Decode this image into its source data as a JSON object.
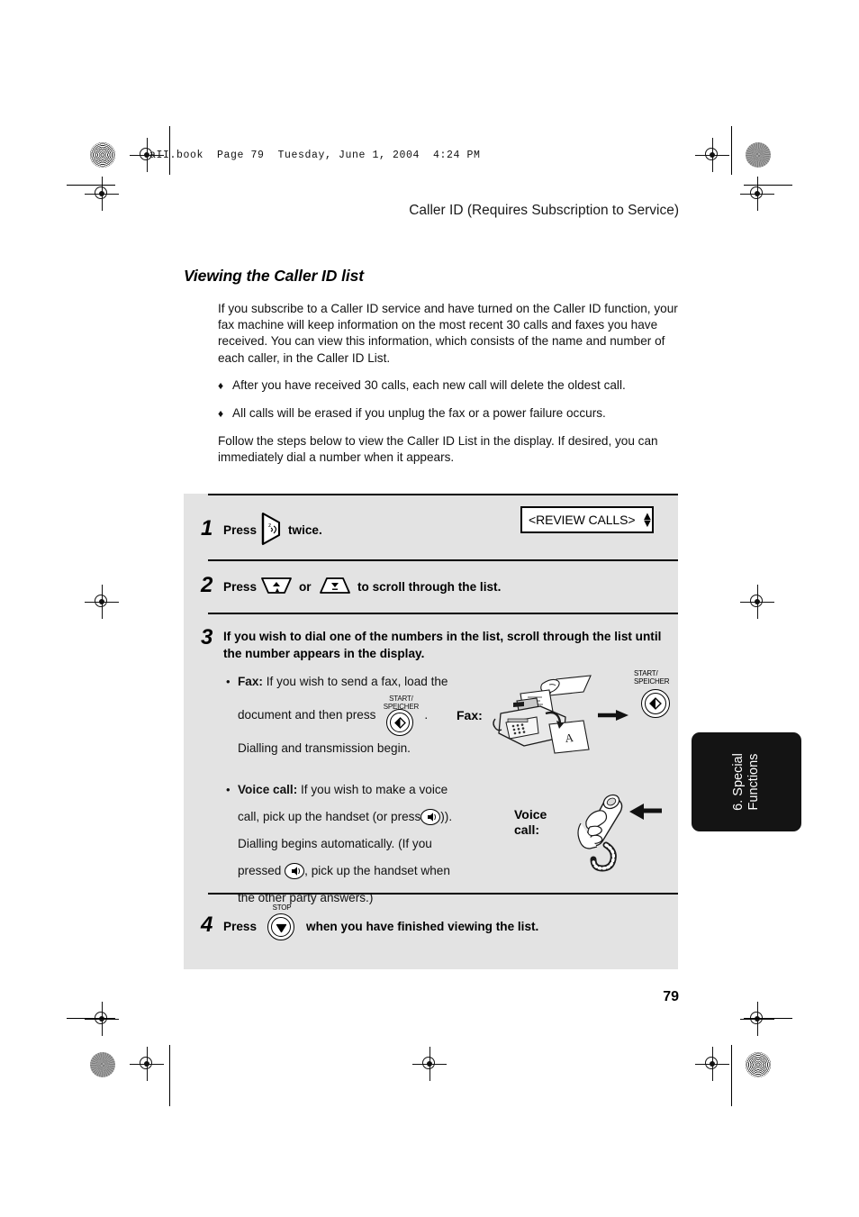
{
  "page": {
    "filename_bar": "aII.book  Page 79  Tuesday, June 1, 2004  4:24 PM",
    "running_head": "Caller ID (Requires Subscription to Service)",
    "section_title": "Viewing the Caller ID list",
    "folio": "79",
    "side_tab": "6. Special\nFunctions",
    "panel_bg": "#e3e3e3",
    "tab_bg": "#141414"
  },
  "intro": {
    "paragraph": "If you subscribe to a Caller ID service and have turned on the Caller ID function, your fax machine will keep information on the most recent 30 calls and faxes you have received. You can view this information, which consists of the name and number of each caller, in the Caller ID List.",
    "bullet_marker": "♦",
    "bullets": [
      "After you have received 30 calls, each new call will delete the oldest call.",
      "All calls will be erased if you unplug the fax or a power failure occurs."
    ],
    "closing": "Follow the steps below to view the Caller ID List in the display. If desired, you can immediately dial a number when it appears."
  },
  "steps": [
    {
      "number": "1",
      "text_before": "Press",
      "key": "function-key",
      "text_after": "twice."
    },
    {
      "number": "2",
      "text_before": "Press",
      "key_up": "up-arrow-key",
      "conjunction": "or",
      "key_down": "down-arrow-key",
      "text_after": "to  scroll through the list."
    },
    {
      "number": "3",
      "text": "If you wish to dial one of the numbers in the list, scroll through the list until the number appears in the display."
    },
    {
      "number": "4",
      "text_before": "Press",
      "key": "stop-key",
      "key_label": "STOP",
      "text_after": "when you have finished viewing the list."
    }
  ],
  "display": {
    "lcd_text": "<REVIEW CALLS>",
    "up_arrow": "▲",
    "down_arrow": "▼"
  },
  "fax_item": {
    "bullet": "•",
    "lead": "Fax:",
    "line1": "If you wish to send a fax, load the",
    "line2_before": "document and then press",
    "key_label": "START/\nSPEICHER",
    "line2_after": ".",
    "line3": "Dialling and transmission begin.",
    "illustration_label": "Fax:",
    "illustration_key_label": "START/\nSPEICHER"
  },
  "voice_item": {
    "bullet": "•",
    "lead": "Voice call:",
    "line1": "If you wish to make a voice",
    "line2_before": "call, pick up the handset (or press",
    "line2_after": ")).",
    "line3": "Dialling begins automatically. (If you",
    "line4_before": "pressed",
    "line4_after": ", pick up the handset when",
    "line5": "the other party answers.)",
    "illustration_label": "Voice\ncall:"
  }
}
